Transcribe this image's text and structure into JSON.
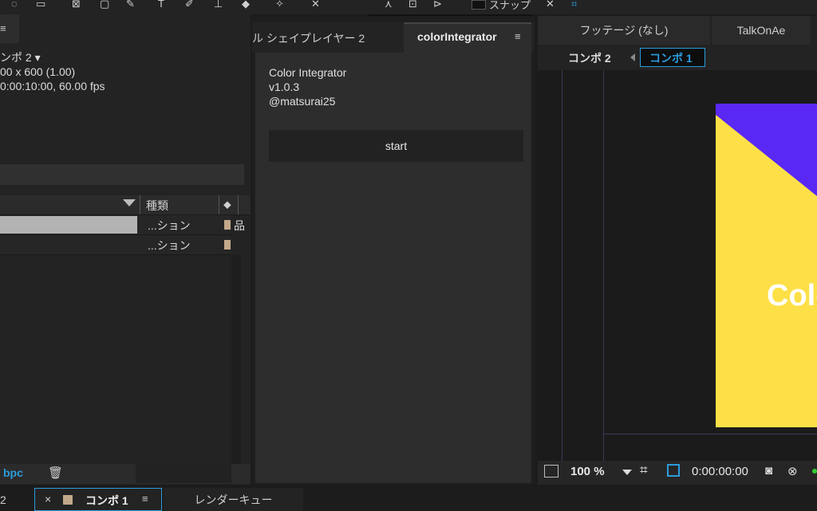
{
  "toolbar": {
    "snap_label": "スナップ"
  },
  "project": {
    "menu_icon": "≡",
    "comp_name": "ンポ 2 ▾",
    "comp_size": "00 x 600 (1.00)",
    "comp_duration": "0:00:10:00, 60.00 fps",
    "columns": {
      "type_header": "種類"
    },
    "rows": [
      {
        "type": "...ション"
      },
      {
        "type": "...ション"
      }
    ],
    "footer": {
      "bpc": "bpc"
    }
  },
  "middle": {
    "tabs": [
      {
        "label": "ル シェイプレイヤー 2"
      },
      {
        "label": "colorIntegrator"
      }
    ],
    "menu_icon": "≡",
    "plugin": {
      "name": "Color Integrator",
      "version": "v1.0.3",
      "author": "@matsurai25"
    },
    "start_label": "start"
  },
  "viewer": {
    "tabs": [
      {
        "label": "フッテージ (なし)"
      },
      {
        "label": "TalkOnAe"
      }
    ],
    "breadcrumbs": [
      {
        "label": "コンポ 2"
      },
      {
        "label": "コンポ 1"
      }
    ],
    "canvas_text": "Colo",
    "zoom": "100 %",
    "timecode": "0:00:00:00"
  },
  "bottom": {
    "left_fragment": "2",
    "close_icon": "×",
    "active_tab": "コンポ 1",
    "menu_icon": "≡",
    "render_queue": "レンダーキュー"
  },
  "colors": {
    "accent_blue": "#2d9cdb",
    "canvas_yellow": "#fde047",
    "canvas_purple": "#5a28f5"
  }
}
